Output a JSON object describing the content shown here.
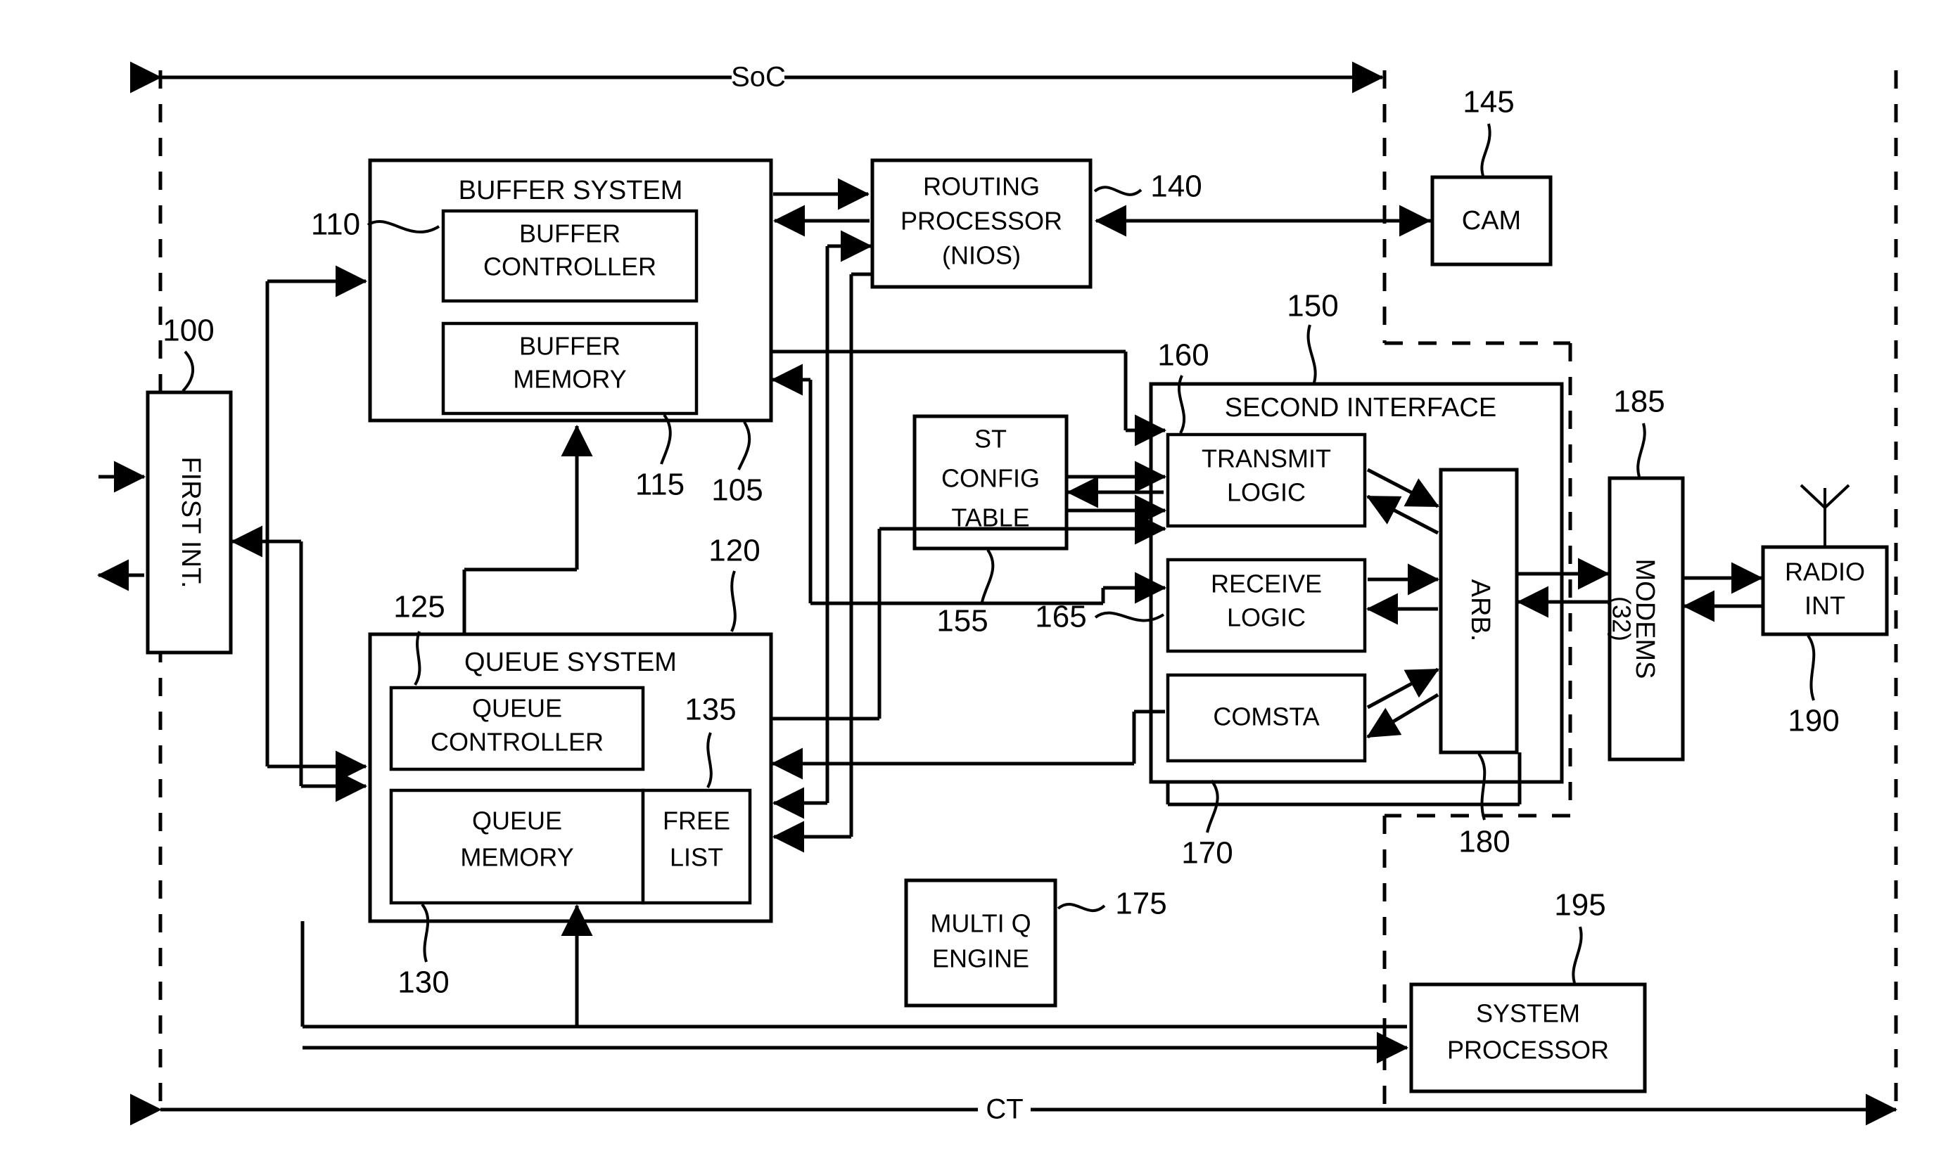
{
  "figure": {
    "type": "patent-block-diagram",
    "span_labels": {
      "top": "SoC",
      "bottom": "CT"
    }
  },
  "blocks": {
    "first_interface": {
      "label": "FIRST INT.",
      "ref": "100",
      "orientation": "vertical"
    },
    "buffer_system": {
      "label": "BUFFER SYSTEM",
      "ref": "105",
      "orientation": "horizontal"
    },
    "buffer_controller": {
      "label_line1": "BUFFER",
      "label_line2": "CONTROLLER",
      "ref": "110",
      "orientation": "horizontal"
    },
    "buffer_memory": {
      "label_line1": "BUFFER",
      "label_line2": "MEMORY",
      "ref": "115",
      "orientation": "horizontal"
    },
    "queue_system": {
      "label": "QUEUE  SYSTEM",
      "ref": "120",
      "orientation": "horizontal"
    },
    "queue_controller": {
      "label_line1": "QUEUE",
      "label_line2": "CONTROLLER",
      "ref": "125",
      "orientation": "horizontal"
    },
    "queue_memory": {
      "label_line1": "QUEUE",
      "label_line2": "MEMORY",
      "ref": "130",
      "orientation": "horizontal"
    },
    "free_list": {
      "label_line1": "FREE",
      "label_line2": "LIST",
      "ref": "135",
      "orientation": "horizontal"
    },
    "routing_processor": {
      "label_line1": "ROUTING",
      "label_line2": "PROCESSOR",
      "label_line3": "(NIOS)",
      "ref": "140",
      "orientation": "horizontal"
    },
    "cam": {
      "label": "CAM",
      "ref": "145",
      "orientation": "horizontal"
    },
    "second_interface": {
      "label": "SECOND INTERFACE",
      "ref": "150",
      "orientation": "horizontal"
    },
    "st_config_table": {
      "label_line1": "ST",
      "label_line2": "CONFIG",
      "label_line3": "TABLE",
      "ref": "155",
      "orientation": "horizontal"
    },
    "transmit_logic": {
      "label_line1": "TRANSMIT",
      "label_line2": "LOGIC",
      "ref": "160",
      "orientation": "horizontal"
    },
    "receive_logic": {
      "label_line1": "RECEIVE",
      "label_line2": "LOGIC",
      "ref": "165",
      "orientation": "horizontal"
    },
    "comsta": {
      "label": "COMSTA",
      "ref": "170",
      "orientation": "horizontal"
    },
    "multi_q_engine": {
      "label_line1": "MULTI Q",
      "label_line2": "ENGINE",
      "ref": "175",
      "orientation": "horizontal"
    },
    "arbiter": {
      "label": "ARB.",
      "ref": "180",
      "orientation": "vertical"
    },
    "modems": {
      "label_line1": "MODEMS",
      "label_line2": "(32)",
      "ref": "185",
      "orientation": "vertical"
    },
    "radio_interface": {
      "label_line1": "RADIO",
      "label_line2": "INT",
      "ref": "190",
      "orientation": "horizontal"
    },
    "system_processor": {
      "label_line1": "SYSTEM",
      "label_line2": "PROCESSOR",
      "ref": "195",
      "orientation": "horizontal"
    }
  },
  "reference_numerals": [
    "100",
    "105",
    "110",
    "115",
    "120",
    "125",
    "130",
    "135",
    "140",
    "145",
    "150",
    "155",
    "160",
    "165",
    "170",
    "175",
    "180",
    "185",
    "190",
    "195"
  ],
  "colors": {
    "line": "#000000",
    "background": "#ffffff",
    "text": "#000000"
  }
}
